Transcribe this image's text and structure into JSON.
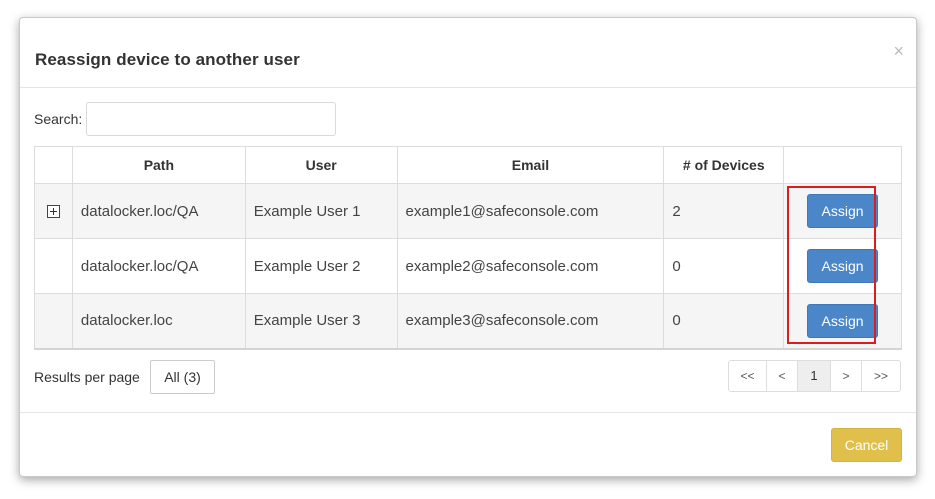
{
  "dialog": {
    "title": "Reassign device to another user",
    "close_icon": "×"
  },
  "search": {
    "label": "Search:",
    "value": "",
    "placeholder": ""
  },
  "table": {
    "columns": [
      "",
      "Path",
      "User",
      "Email",
      "# of Devices",
      ""
    ],
    "rows": [
      {
        "expandable": true,
        "path": "datalocker.loc/QA",
        "user": "Example User 1",
        "email": "example1@safeconsole.com",
        "devices": "2",
        "action": "Assign"
      },
      {
        "expandable": false,
        "path": "datalocker.loc/QA",
        "user": "Example User 2",
        "email": "example2@safeconsole.com",
        "devices": "0",
        "action": "Assign"
      },
      {
        "expandable": false,
        "path": "datalocker.loc",
        "user": "Example User 3",
        "email": "example3@safeconsole.com",
        "devices": "0",
        "action": "Assign"
      }
    ]
  },
  "pagination": {
    "results_per_page_label": "Results per page",
    "results_per_page_value": "All (3)",
    "first": "<<",
    "prev": "<",
    "current_page": "1",
    "next": ">",
    "last": ">>"
  },
  "footer": {
    "cancel_label": "Cancel"
  },
  "colors": {
    "assign_button": "#4a86c8",
    "cancel_button": "#e0c04a",
    "highlight_box": "#d81e1e"
  }
}
